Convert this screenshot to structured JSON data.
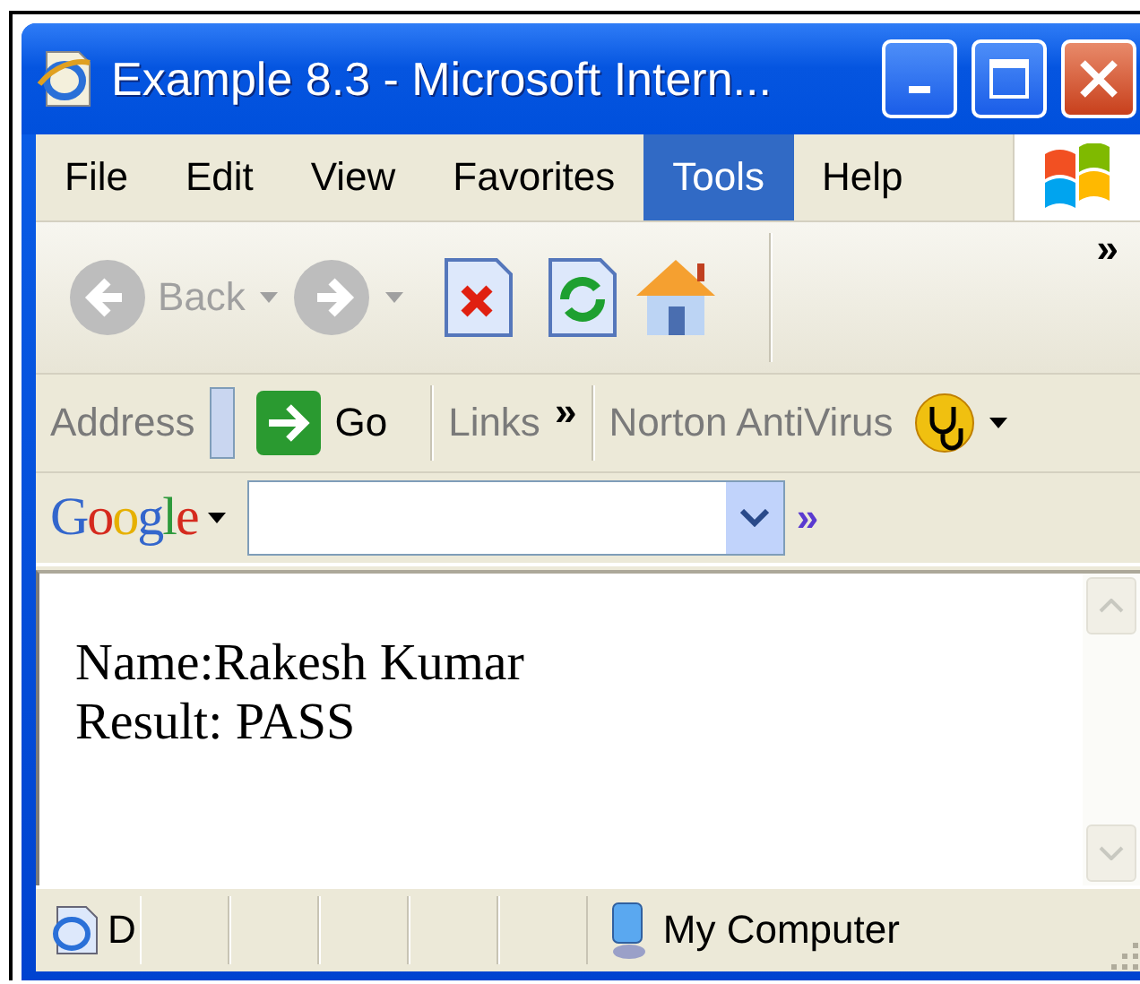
{
  "window": {
    "title": "Example 8.3 - Microsoft Intern..."
  },
  "menu": [
    {
      "label": "File",
      "selected": false
    },
    {
      "label": "Edit",
      "selected": false
    },
    {
      "label": "View",
      "selected": false
    },
    {
      "label": "Favorites",
      "selected": false
    },
    {
      "label": "Tools",
      "selected": true
    },
    {
      "label": "Help",
      "selected": false
    }
  ],
  "toolbar": {
    "back": {
      "label": "Back",
      "disabled": true
    },
    "forward": {
      "disabled": true
    },
    "chevron": "»"
  },
  "address_bar": {
    "address_label": "Address",
    "go_label": "Go",
    "links_label": "Links",
    "links_chevron": "»",
    "norton_label": "Norton AntiVirus"
  },
  "google_bar": {
    "logo": "Google",
    "chevron": "»"
  },
  "content": {
    "lines": [
      "Name:Rakesh Kumar",
      "Result: PASS"
    ]
  },
  "status_bar": {
    "text": "D",
    "zone": "My Computer"
  }
}
